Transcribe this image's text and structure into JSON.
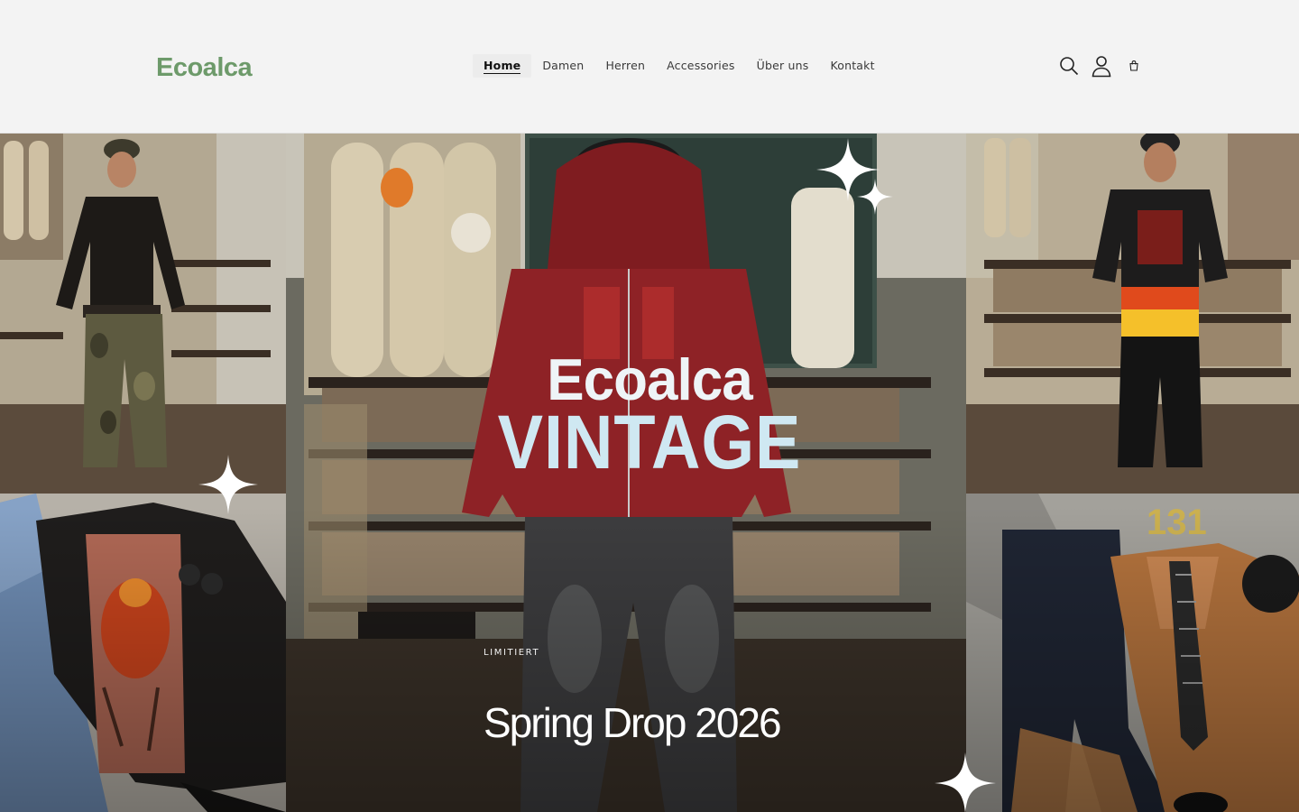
{
  "header": {
    "logo": "Ecoalca",
    "nav": [
      {
        "label": "Home",
        "active": true
      },
      {
        "label": "Damen",
        "active": false
      },
      {
        "label": "Herren",
        "active": false
      },
      {
        "label": "Accessories",
        "active": false
      },
      {
        "label": "Über uns",
        "active": false
      },
      {
        "label": "Kontakt",
        "active": false
      }
    ],
    "icons": [
      "search-icon",
      "account-icon",
      "cart-icon"
    ]
  },
  "hero": {
    "brand_title": "Ecoalca",
    "brand_subtitle": "VINTAGE",
    "eyebrow": "LIMITIERT",
    "headline": "Spring Drop 2026"
  },
  "colors": {
    "logo_green": "#6d9a6a",
    "header_bg": "#f3f3f3",
    "brand_sub_blue": "#cfe8f2",
    "hoodie_red": "#8e2226"
  }
}
